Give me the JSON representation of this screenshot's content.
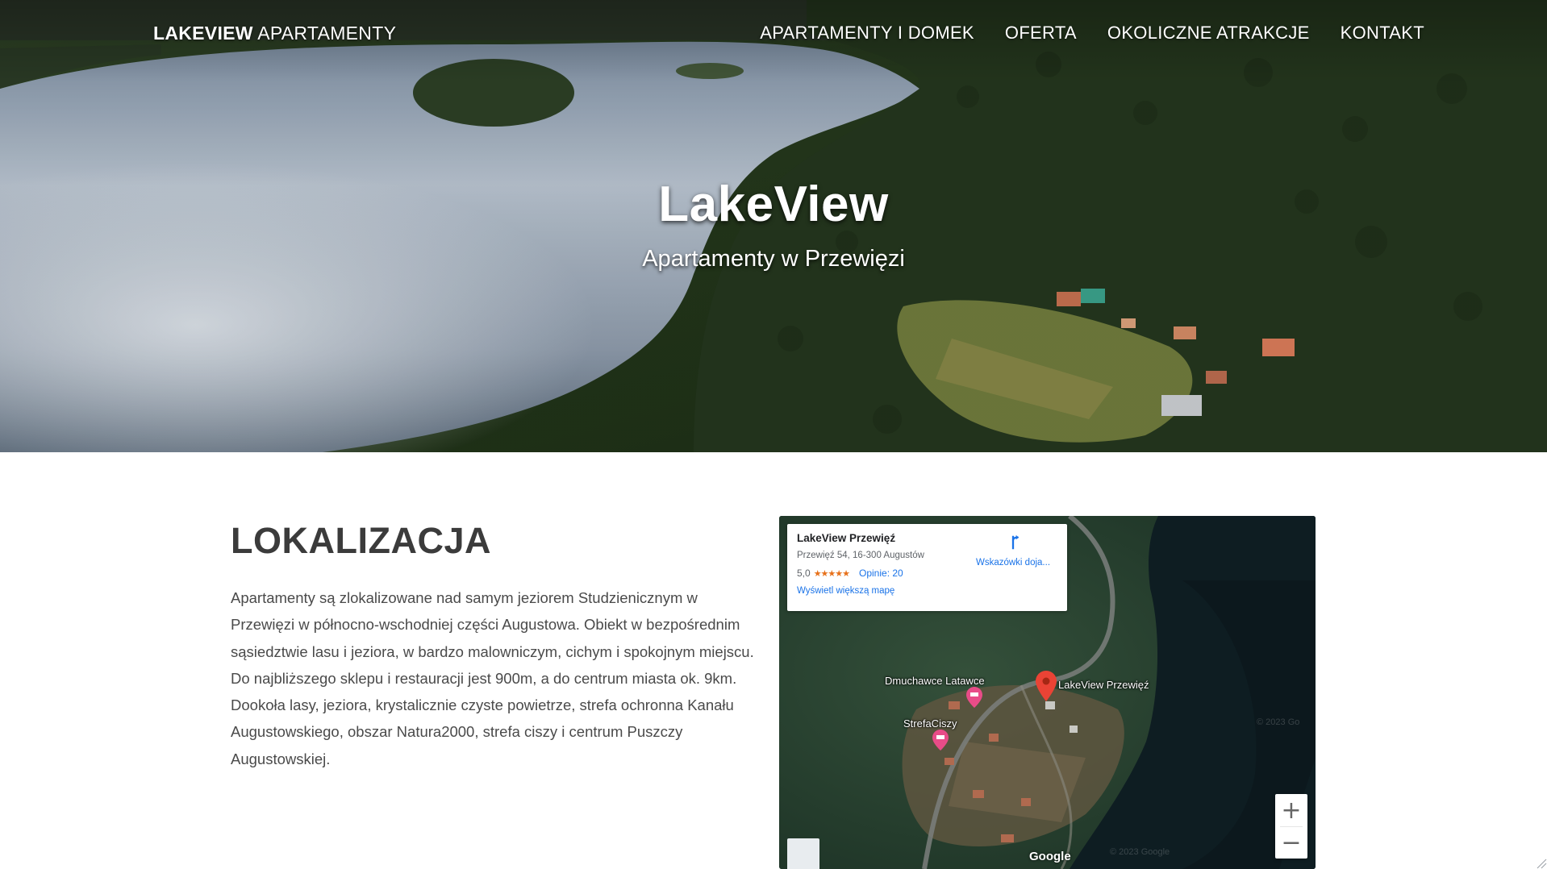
{
  "nav": {
    "brand_bold": "LAKEVIEW",
    "brand_light": "APARTAMENTY",
    "items": [
      {
        "label": "APARTAMENTY I DOMEK"
      },
      {
        "label": "OFERTA"
      },
      {
        "label": "OKOLICZNE ATRAKCJE"
      },
      {
        "label": "KONTAKT"
      }
    ]
  },
  "hero": {
    "title": "LakeView",
    "subtitle": "Apartamenty w Przewięzi"
  },
  "location": {
    "heading": "LOKALIZACJA",
    "description": "Apartamenty są zlokalizowane nad samym jeziorem Studzienicznym w Przewięzi w północno-wschodniej części Augustowa. Obiekt w bezpośrednim sąsiedztwie lasu i jeziora, w bardzo malowniczym, cichym i spokojnym miejscu. Do najbliższego sklepu i restauracji jest 900m, a do centrum miasta ok. 9km. Dookoła lasy, jeziora, krystalicznie czyste powietrze, strefa ochronna Kanału Augustowskiego, obszar Natura2000, strefa ciszy i centrum Puszczy Augustowskiej."
  },
  "map": {
    "place_name": "LakeView Przewięź",
    "address": "Przewięź 54, 16-300 Augustów",
    "rating": "5,0",
    "stars": "★★★★★",
    "reviews": "Opinie: 20",
    "bigger_map": "Wyświetl większą mapę",
    "directions": "Wskazówki doja...",
    "labels": {
      "marker": "LakeView Przewięź",
      "poi1": "Dmuchawce Latawce",
      "poi2": "StrefaCiszy"
    },
    "zoom_in": "+",
    "zoom_out": "−",
    "attribution": "Google",
    "copyright": "© 2023 Google",
    "copyright_side": "© 2023 Go"
  },
  "colors": {
    "link_blue": "#1a73e8",
    "star_orange": "#e7711b",
    "marker_red": "#ea4335",
    "poi_pink": "#e84c88"
  }
}
